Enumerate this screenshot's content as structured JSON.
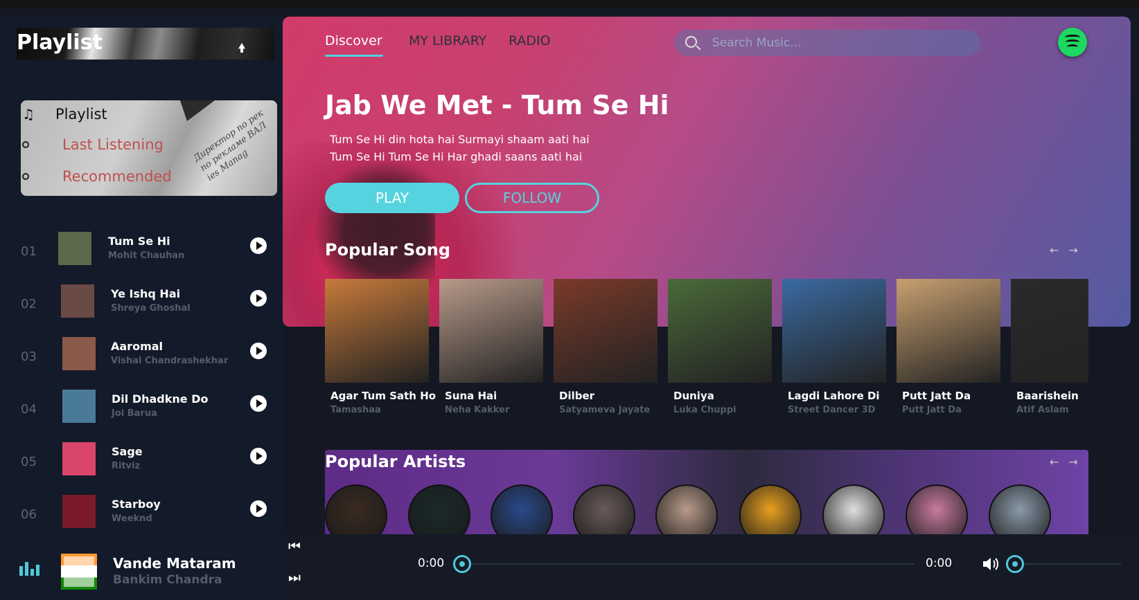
{
  "sidebar": {
    "title": "Playlist",
    "menu": [
      {
        "label": "Playlist",
        "icon": "music-note-icon"
      },
      {
        "label": "Last Listening",
        "icon": "radio-dot-icon"
      },
      {
        "label": "Recommended",
        "icon": "radio-dot-icon"
      }
    ],
    "tracks": [
      {
        "num": "01",
        "title": "Tum Se Hi",
        "artist": "Mohit Chauhan",
        "color": "#5a6a4a"
      },
      {
        "num": "02",
        "title": "Ye Ishq Hai",
        "artist": "Shreya Ghoshal",
        "color": "#6a4a44"
      },
      {
        "num": "03",
        "title": "Aaromal",
        "artist": "Vishal Chandrashekhar",
        "color": "#8a5a4a"
      },
      {
        "num": "04",
        "title": "Dil Dhadkne Do",
        "artist": "Joi Barua",
        "color": "#4a7a9a"
      },
      {
        "num": "05",
        "title": "Sage",
        "artist": "Ritviz",
        "color": "#d9466a"
      },
      {
        "num": "06",
        "title": "Starboy",
        "artist": "Weeknd",
        "color": "#7a1a2a"
      }
    ],
    "now_playing": {
      "title": "Vande Mataram",
      "artist": "Bankim Chandra"
    }
  },
  "nav": {
    "tabs": [
      "Discover",
      "MY LIBRARY",
      "RADIO"
    ],
    "active": "Discover",
    "search_placeholder": "Search Music..."
  },
  "hero": {
    "title": "Jab We Met - Tum Se Hi",
    "lines": [
      "Tum Se Hi din hota hai Surmayi shaam aati hai",
      "Tum Se Hi Tum Se Hi Har ghadi saans aati hai"
    ],
    "play_label": "PLAY",
    "follow_label": "FOLLOW"
  },
  "popular_songs": {
    "title": "Popular Song",
    "items": [
      {
        "title": "Agar Tum Sath Ho",
        "sub": "Tamashaa",
        "color": "#c77a3a"
      },
      {
        "title": "Suna Hai",
        "sub": "Neha Kakker",
        "color": "#b89a8a"
      },
      {
        "title": "Dilber",
        "sub": "Satyameva Jayate",
        "color": "#7a3a2a"
      },
      {
        "title": "Duniya",
        "sub": "Luka Chuppi",
        "color": "#4a6a3a"
      },
      {
        "title": "Lagdi Lahore Di",
        "sub": "Street Dancer 3D",
        "color": "#3a6aa0"
      },
      {
        "title": "Putt Jatt Da",
        "sub": "Putt Jatt Da",
        "color": "#c8a070"
      },
      {
        "title": "Baarishein",
        "sub": "Atif Aslam",
        "color": "#2a2a2a"
      }
    ]
  },
  "popular_artists": {
    "title": "Popular Artists",
    "colors": [
      "#3a2a20",
      "#1a2a2a",
      "#2a4a8a",
      "#6a5a5a",
      "#b89a8a",
      "#e8a020",
      "#e0e0e0",
      "#c87aa0",
      "#8a9aaa"
    ]
  },
  "player": {
    "current_time": "0:00",
    "duration": "0:00"
  }
}
